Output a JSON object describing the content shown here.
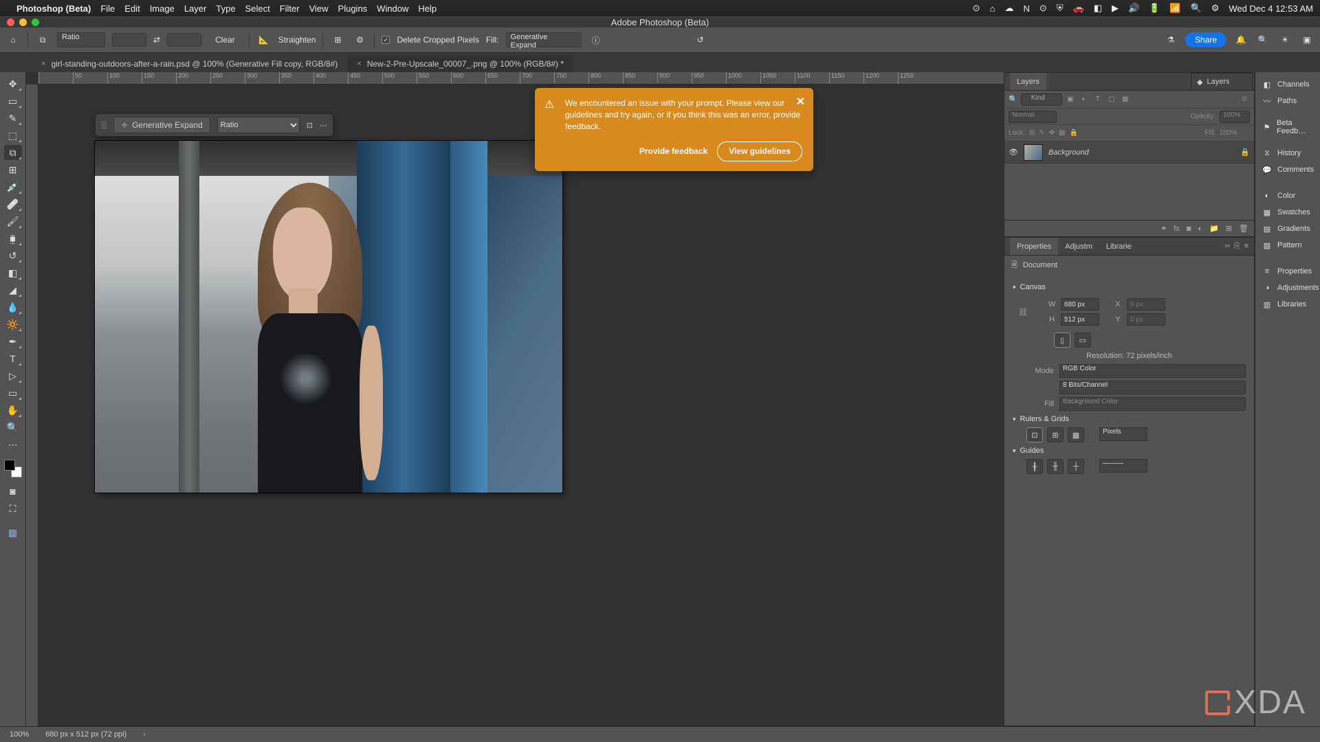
{
  "menubar": {
    "app": "Photoshop (Beta)",
    "items": [
      "File",
      "Edit",
      "Image",
      "Layer",
      "Type",
      "Select",
      "Filter",
      "View",
      "Plugins",
      "Window",
      "Help"
    ],
    "clock": "Wed Dec 4  12:53 AM"
  },
  "window": {
    "title": "Adobe Photoshop (Beta)"
  },
  "optionsbar": {
    "ratio_label": "Ratio",
    "clear": "Clear",
    "straighten": "Straighten",
    "delete_cropped": "Delete Cropped Pixels",
    "fill_label": "Fill:",
    "fill_value": "Generative Expand",
    "share": "Share"
  },
  "tabs": [
    {
      "label": "girl-standing-outdoors-after-a-rain.psd @ 100% (Generative Fill copy, RGB/8#)",
      "active": false
    },
    {
      "label": "New-2-Pre-Upscale_00007_.png @ 100% (RGB/8#) *",
      "active": true
    }
  ],
  "contextbar": {
    "genexpand": "Generative Expand",
    "ratio": "Ratio"
  },
  "alert": {
    "message": "We encountered an issue with your prompt. Please view our guidelines and try again, or if you think this was an error, provide feedback.",
    "feedback": "Provide feedback",
    "guidelines": "View guidelines"
  },
  "ruler_ticks": [
    "",
    "50",
    "100",
    "150",
    "200",
    "250",
    "300",
    "350",
    "400",
    "450",
    "500",
    "550",
    "600",
    "650",
    "700",
    "750",
    "800",
    "850",
    "900",
    "950",
    "1000",
    "1050",
    "1100",
    "1150",
    "1200",
    "1250"
  ],
  "layers": {
    "title": "Layers",
    "kind_placeholder": "Kind",
    "blend": "Normal",
    "opacity_label": "Opacity:",
    "opacity": "100%",
    "lock_label": "Lock:",
    "fill_label": "Fill:",
    "fill_val": "100%",
    "rows": [
      {
        "name": "Background"
      }
    ]
  },
  "right_icon_panels": [
    "Channels",
    "Paths",
    "",
    "Beta Feedb…",
    "",
    "History",
    "Comments",
    "",
    "Color",
    "Swatches",
    "Gradients",
    "Pattern",
    "",
    "Properties",
    "Adjustments",
    "Libraries"
  ],
  "right_icon_glyphs": [
    "◧",
    "〰",
    "",
    "⚑",
    "",
    "⧖",
    "💬",
    "",
    "◐",
    "▦",
    "▤",
    "▨",
    "",
    "≡",
    "◑",
    "▥"
  ],
  "properties": {
    "title": "Properties",
    "adjust_tab": "Adjustm",
    "lib_tab": "Librarie",
    "docicon_label": "Document",
    "canvas_hdr": "Canvas",
    "w": "680 px",
    "h": "512 px",
    "x": "0 px",
    "y": "0 px",
    "resolution": "Resolution: 72 pixels/inch",
    "mode_label": "Mode",
    "mode": "RGB Color",
    "depth": "8 Bits/Channel",
    "fill_label": "Fill",
    "fill_value": "Background Color",
    "rulers_hdr": "Rulers & Grids",
    "rulers_unit": "Pixels",
    "guides_hdr": "Guides"
  },
  "status": {
    "zoom": "100%",
    "docinfo": "680 px x 512 px (72 ppi)"
  },
  "watermark": "XDA"
}
